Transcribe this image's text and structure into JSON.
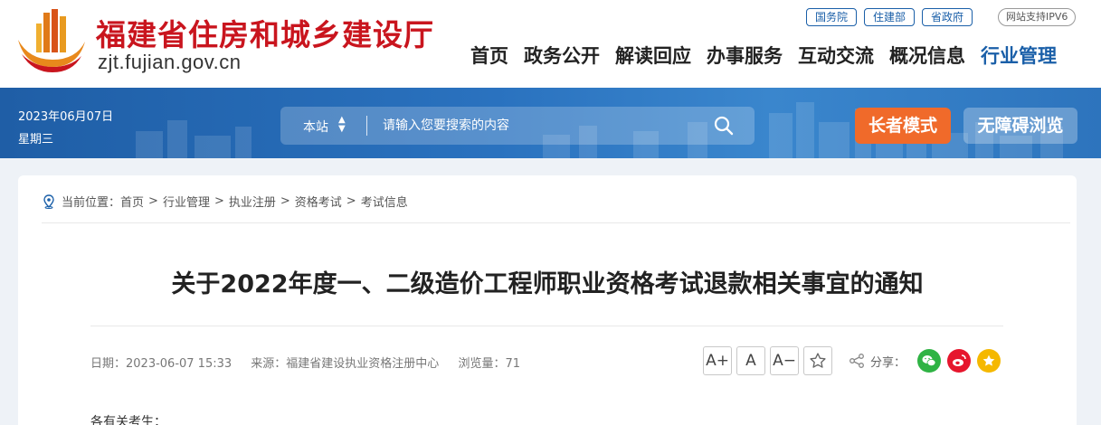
{
  "header": {
    "site_name": "福建省住房和城乡建设厅",
    "site_url": "zjt.fujian.gov.cn",
    "quick_links": [
      "国务院",
      "住建部",
      "省政府"
    ],
    "ipv6": "网站支持IPV6",
    "nav": [
      "首页",
      "政务公开",
      "解读回应",
      "办事服务",
      "互动交流",
      "概况信息",
      "行业管理"
    ],
    "nav_active": "行业管理"
  },
  "banner": {
    "date": "2023年06月07日",
    "weekday": "星期三",
    "search_scope": "本站",
    "search_placeholder": "请输入您要搜索的内容",
    "elder_mode": "长者模式",
    "accessible": "无障碍浏览"
  },
  "breadcrumb": {
    "prefix": "当前位置：",
    "items": [
      "首页",
      "行业管理",
      "执业注册",
      "资格考试",
      "考试信息"
    ]
  },
  "article": {
    "title": "关于2022年度一、二级造价工程师职业资格考试退款相关事宜的通知",
    "date": "日期：2023-06-07 15:33",
    "source": "来源：福建省建设执业资格注册中心",
    "views": "浏览量：71",
    "body_start": "各有关考生："
  },
  "tools": {
    "font_increase": "A+",
    "font_normal": "A",
    "font_decrease": "A−",
    "share_label": "分享："
  },
  "colors": {
    "brand_red": "#c9151e",
    "brand_blue": "#1a5fa8",
    "elder_orange": "#f06a2a",
    "wechat": "#2fb344",
    "weibo": "#e6162d",
    "qzone": "#f5b800"
  }
}
